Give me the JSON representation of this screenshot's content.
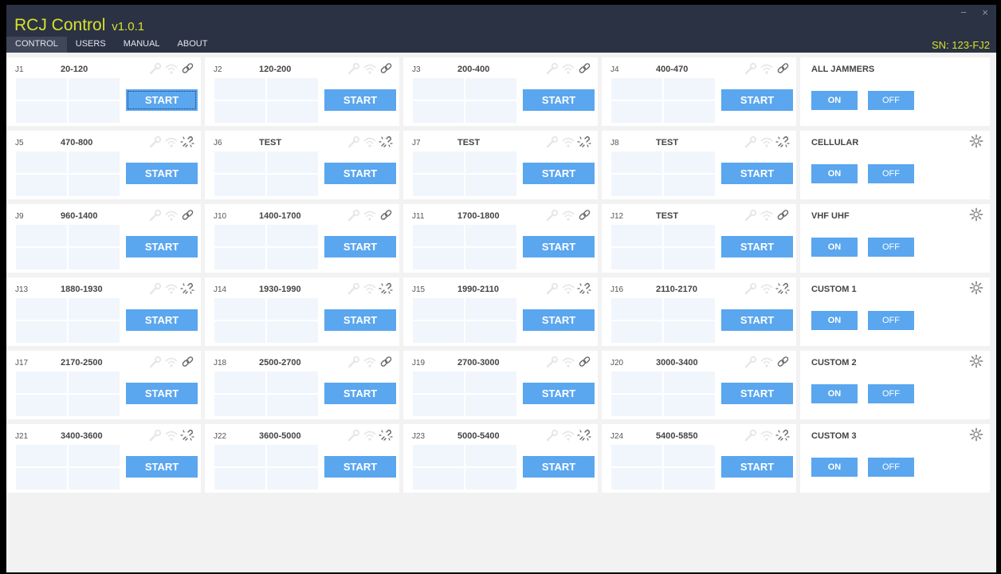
{
  "app": {
    "title": "RCJ Control",
    "version": "v1.0.1",
    "serial": "SN: 123-FJ2",
    "minimize": "−",
    "close": "×"
  },
  "nav": [
    "CONTROL",
    "USERS",
    "MANUAL",
    "ABOUT"
  ],
  "nav_active": "CONTROL",
  "start_label": "START",
  "on_label": "ON",
  "off_label": "OFF",
  "jammers": [
    {
      "id": "J1",
      "range": "20-120",
      "link": "linked"
    },
    {
      "id": "J2",
      "range": "120-200",
      "link": "linked"
    },
    {
      "id": "J3",
      "range": "200-400",
      "link": "linked"
    },
    {
      "id": "J4",
      "range": "400-470",
      "link": "linked"
    },
    {
      "id": "J5",
      "range": "470-800",
      "link": "broken"
    },
    {
      "id": "J6",
      "range": "TEST",
      "link": "broken"
    },
    {
      "id": "J7",
      "range": "TEST",
      "link": "broken"
    },
    {
      "id": "J8",
      "range": "TEST",
      "link": "broken"
    },
    {
      "id": "J9",
      "range": "960-1400",
      "link": "linked"
    },
    {
      "id": "J10",
      "range": "1400-1700",
      "link": "linked"
    },
    {
      "id": "J11",
      "range": "1700-1800",
      "link": "linked"
    },
    {
      "id": "J12",
      "range": "TEST",
      "link": "linked"
    },
    {
      "id": "J13",
      "range": "1880-1930",
      "link": "broken"
    },
    {
      "id": "J14",
      "range": "1930-1990",
      "link": "broken"
    },
    {
      "id": "J15",
      "range": "1990-2110",
      "link": "broken"
    },
    {
      "id": "J16",
      "range": "2110-2170",
      "link": "broken"
    },
    {
      "id": "J17",
      "range": "2170-2500",
      "link": "linked"
    },
    {
      "id": "J18",
      "range": "2500-2700",
      "link": "linked"
    },
    {
      "id": "J19",
      "range": "2700-3000",
      "link": "linked"
    },
    {
      "id": "J20",
      "range": "3000-3400",
      "link": "linked"
    },
    {
      "id": "J21",
      "range": "3400-3600",
      "link": "broken"
    },
    {
      "id": "J22",
      "range": "3600-5000",
      "link": "broken"
    },
    {
      "id": "J23",
      "range": "5000-5400",
      "link": "broken"
    },
    {
      "id": "J24",
      "range": "5400-5850",
      "link": "broken"
    }
  ],
  "groups": [
    {
      "name": "ALL JAMMERS",
      "gear": false
    },
    {
      "name": "CELLULAR",
      "gear": true
    },
    {
      "name": "VHF UHF",
      "gear": true
    },
    {
      "name": "CUSTOM 1",
      "gear": true
    },
    {
      "name": "CUSTOM 2",
      "gear": true
    },
    {
      "name": "CUSTOM 3",
      "gear": true
    }
  ],
  "colors": {
    "titlebar": "#2b3244",
    "accent_yellow": "#d7e12a",
    "button_blue": "#5aa6ef",
    "card": "#ffffff",
    "background": "#f2f2f2"
  },
  "icons": {
    "linked": "link-icon",
    "broken": "unlink-icon",
    "tool": "wrench-icon",
    "signal": "wifi-icon",
    "settings": "gear-icon"
  }
}
